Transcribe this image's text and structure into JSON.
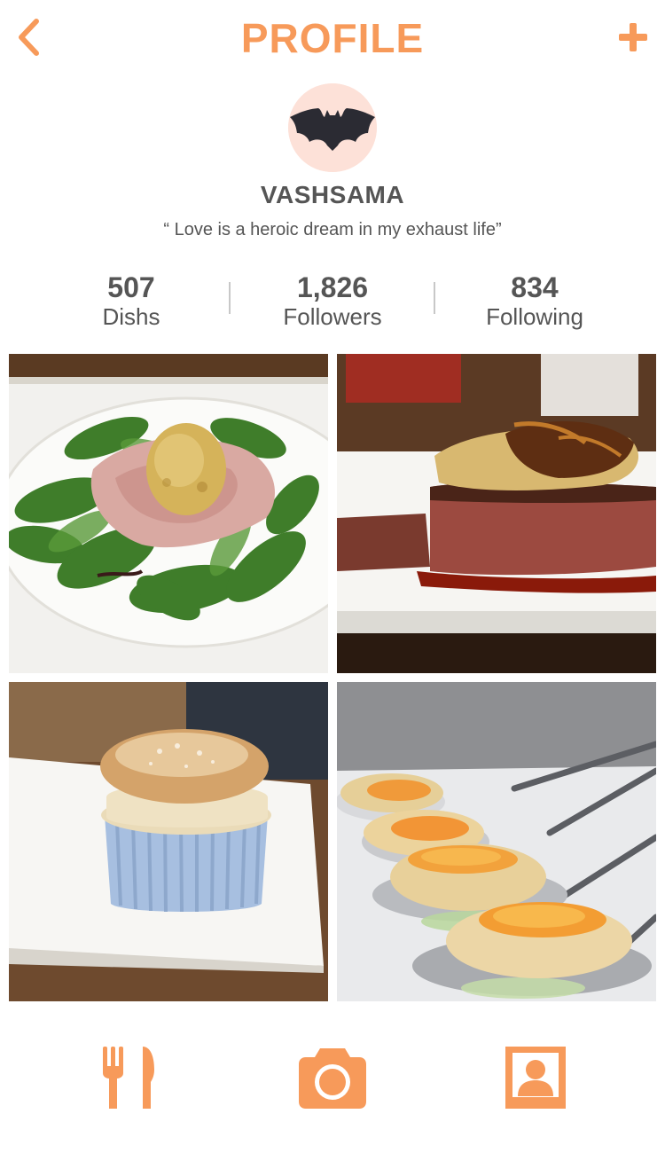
{
  "header": {
    "title": "PROFILE",
    "back_icon": "chevron-left-icon",
    "add_icon": "plus-icon",
    "accent_color": "#f79a5a"
  },
  "profile": {
    "avatar_icon": "bat-logo-icon",
    "username": "VASHSAMA",
    "bio": "“ Love is a heroic dream in my exhaust life”"
  },
  "stats": [
    {
      "value": "507",
      "label": "Dishs"
    },
    {
      "value": "1,826",
      "label": "Followers"
    },
    {
      "value": "834",
      "label": "Following"
    }
  ],
  "photos": [
    {
      "subject": "prosciutto-salad-with-croquette"
    },
    {
      "subject": "steak-with-foie-gras"
    },
    {
      "subject": "souffle-in-ramekin"
    },
    {
      "subject": "soft-boiled-eggs-on-spoons"
    }
  ],
  "tabbar": {
    "items": [
      {
        "icon": "fork-knife-icon"
      },
      {
        "icon": "camera-icon"
      },
      {
        "icon": "profile-card-icon"
      }
    ]
  }
}
